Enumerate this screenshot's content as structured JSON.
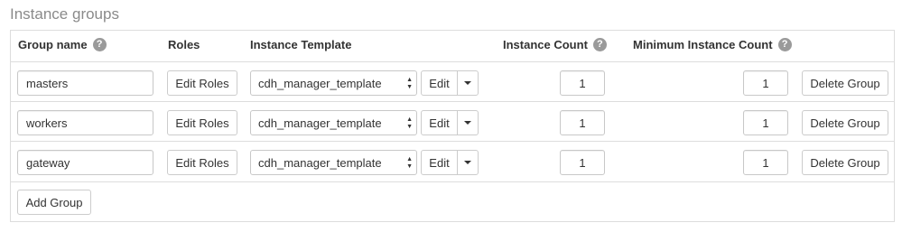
{
  "section": {
    "title": "Instance groups"
  },
  "headers": {
    "group_name": "Group name",
    "roles": "Roles",
    "instance_template": "Instance Template",
    "instance_count": "Instance Count",
    "min_instance_count": "Minimum Instance Count",
    "help_glyph": "?"
  },
  "rows": [
    {
      "group_name": "masters",
      "edit_roles_label": "Edit Roles",
      "template": "cdh_manager_template",
      "edit_label": "Edit",
      "instance_count": "1",
      "min_instance_count": "1",
      "delete_label": "Delete Group"
    },
    {
      "group_name": "workers",
      "edit_roles_label": "Edit Roles",
      "template": "cdh_manager_template",
      "edit_label": "Edit",
      "instance_count": "1",
      "min_instance_count": "1",
      "delete_label": "Delete Group"
    },
    {
      "group_name": "gateway",
      "edit_roles_label": "Edit Roles",
      "template": "cdh_manager_template",
      "edit_label": "Edit",
      "instance_count": "1",
      "min_instance_count": "1",
      "delete_label": "Delete Group"
    }
  ],
  "footer": {
    "add_group_label": "Add Group"
  },
  "icons": {
    "help": "help-circle-icon",
    "select": "select-updown-arrows-icon",
    "dropdown": "caret-down-icon"
  }
}
